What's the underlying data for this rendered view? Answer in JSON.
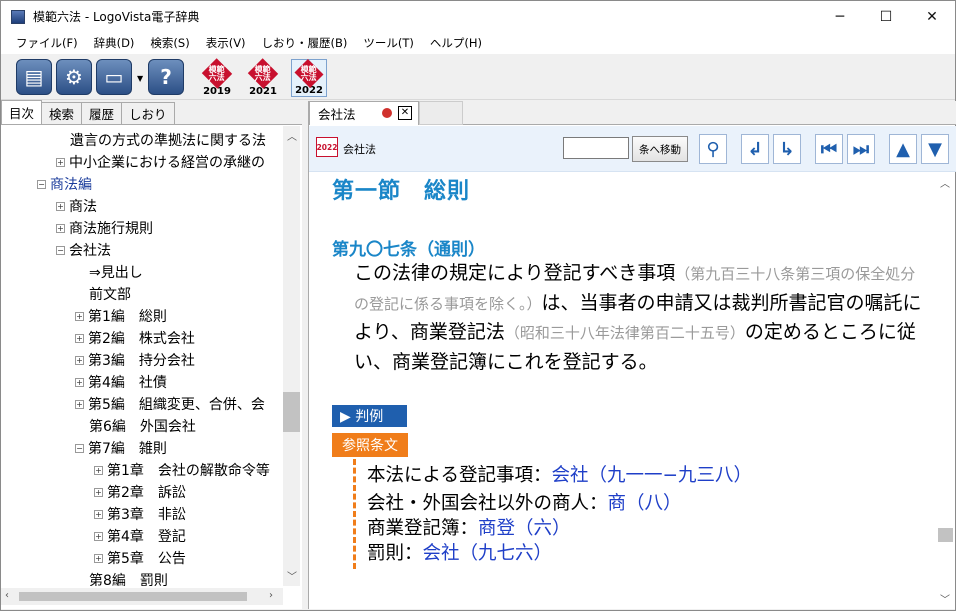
{
  "window": {
    "title": "模範六法 - LogoVista電子辞典",
    "minimize": "─",
    "maximize": "☐",
    "close": "✕"
  },
  "menu": [
    "ファイル(F)",
    "辞典(D)",
    "検索(S)",
    "表示(V)",
    "しおり・履歴(B)",
    "ツール(T)",
    "ヘルプ(H)"
  ],
  "toolbar": {
    "buttons": [
      {
        "name": "dictionary-list-icon",
        "glyph": "▤"
      },
      {
        "name": "settings-gear-icon",
        "glyph": "⚙"
      },
      {
        "name": "print-icon",
        "glyph": "▭"
      },
      {
        "name": "help-icon",
        "glyph": "?"
      }
    ],
    "books": [
      {
        "brand": "模範\n六法",
        "year": "2019"
      },
      {
        "brand": "模範\n六法",
        "year": "2021"
      },
      {
        "brand": "模範\n六法",
        "year": "2022"
      }
    ]
  },
  "left_tabs": [
    "目次",
    "検索",
    "履歴",
    "しおり"
  ],
  "tree": [
    {
      "label": "遺言の方式の準拠法に関する法",
      "indent": 1,
      "toggle": "",
      "link": false
    },
    {
      "label": "中小企業における経営の承継の",
      "indent": 1,
      "toggle": "+",
      "link": false
    },
    {
      "label": "商法編",
      "indent": 0,
      "toggle": "−",
      "link": true
    },
    {
      "label": "商法",
      "indent": 1,
      "toggle": "+",
      "link": false
    },
    {
      "label": "商法施行規則",
      "indent": 1,
      "toggle": "+",
      "link": false
    },
    {
      "label": "会社法",
      "indent": 1,
      "toggle": "−",
      "link": false
    },
    {
      "label": "⇒見出し",
      "indent": 2,
      "toggle": "",
      "link": false
    },
    {
      "label": "前文部",
      "indent": 2,
      "toggle": "",
      "link": false
    },
    {
      "label": "第1編　総則",
      "indent": 2,
      "toggle": "+",
      "link": false
    },
    {
      "label": "第2編　株式会社",
      "indent": 2,
      "toggle": "+",
      "link": false
    },
    {
      "label": "第3編　持分会社",
      "indent": 2,
      "toggle": "+",
      "link": false
    },
    {
      "label": "第4編　社債",
      "indent": 2,
      "toggle": "+",
      "link": false
    },
    {
      "label": "第5編　組織変更、合併、会",
      "indent": 2,
      "toggle": "+",
      "link": false
    },
    {
      "label": "第6編　外国会社",
      "indent": 2,
      "toggle": "",
      "link": false
    },
    {
      "label": "第7編　雑則",
      "indent": 2,
      "toggle": "−",
      "link": false
    },
    {
      "label": "第1章　会社の解散命令等",
      "indent": 3,
      "toggle": "+",
      "link": false
    },
    {
      "label": "第2章　訴訟",
      "indent": 3,
      "toggle": "+",
      "link": false
    },
    {
      "label": "第3章　非訟",
      "indent": 3,
      "toggle": "+",
      "link": false
    },
    {
      "label": "第4章　登記",
      "indent": 3,
      "toggle": "+",
      "link": false
    },
    {
      "label": "第5章　公告",
      "indent": 3,
      "toggle": "+",
      "link": false
    },
    {
      "label": "第8編　罰則",
      "indent": 2,
      "toggle": "",
      "link": false
    }
  ],
  "doc_tab": {
    "label": "会社法"
  },
  "docbar": {
    "year": "2022",
    "title": "会社法",
    "jump_label": "条へ移動",
    "jump_value": ""
  },
  "content": {
    "section": "第一節　総則",
    "article": "第九〇七条（通則）",
    "body": [
      {
        "t": "この法律の規定により登記すべき事項",
        "note": false
      },
      {
        "t": "（第九百三十八条第三項の保全処分の登記に係る事項を除く。）",
        "note": true
      },
      {
        "t": "は、当事者の申請又は裁判所書記官の嘱託により、商業登記法",
        "note": false
      },
      {
        "t": "（昭和三十八年法律第百二十五号）",
        "note": true
      },
      {
        "t": "の定めるところに従い、商業登記簿にこれを登記する。",
        "note": false
      }
    ],
    "hanrei": "▶ 判例",
    "sansho": "参照条文",
    "refs": [
      {
        "prefix": "本法による登記事項：",
        "link": "会社（九一一−九三八）"
      },
      {
        "prefix": "会社・外国会社以外の商人：",
        "link": "商（八）"
      },
      {
        "prefix": "商業登記簿：",
        "link": "商登（六）"
      },
      {
        "prefix": "罰則：",
        "link": "会社（九七六）"
      }
    ]
  }
}
